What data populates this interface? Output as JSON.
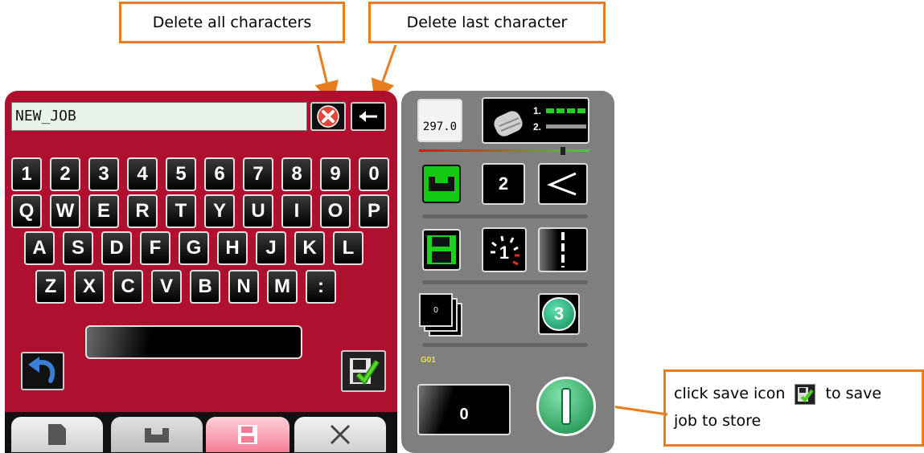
{
  "annotations": {
    "delete_all": "Delete all characters",
    "delete_last": "Delete last character",
    "save_line1": "click save icon",
    "save_line1_end": "to save",
    "save_line2": "job to store"
  },
  "keyboard": {
    "job_name": "NEW_JOB",
    "rows": [
      [
        "1",
        "2",
        "3",
        "4",
        "5",
        "6",
        "7",
        "8",
        "9",
        "0"
      ],
      [
        "Q",
        "W",
        "E",
        "R",
        "T",
        "Y",
        "U",
        "I",
        "O",
        "P"
      ],
      [
        "A",
        "S",
        "D",
        "F",
        "G",
        "H",
        "J",
        "K",
        "L"
      ],
      [
        "Z",
        "X",
        "C",
        "V",
        "B",
        "N",
        "M",
        ":"
      ]
    ]
  },
  "status": {
    "length_value": "297.0",
    "stitch_count": "2",
    "sequence_number": "1",
    "stack_count": "0",
    "badge_number": "3",
    "program_label": "G01",
    "counter_value": "0",
    "cylinder_marks": [
      "1.",
      "2."
    ]
  },
  "colors": {
    "panel": "#b01030",
    "accent": "#e87d1e",
    "green": "#1ec81e"
  }
}
